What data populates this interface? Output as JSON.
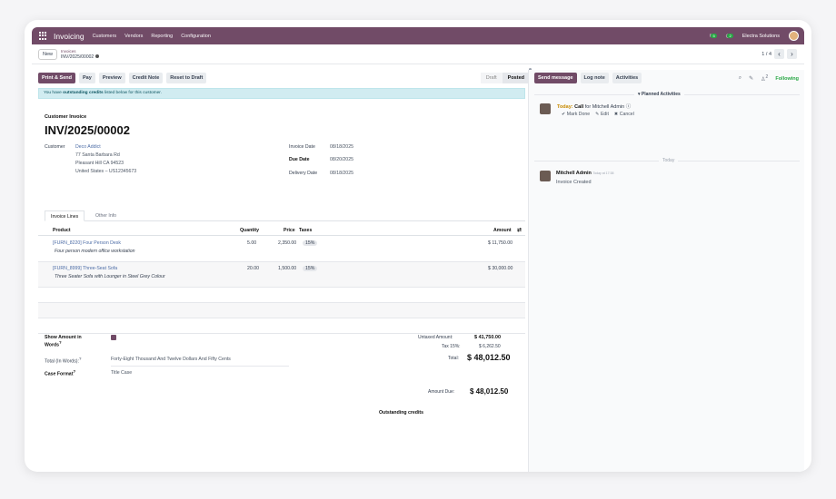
{
  "topnav": {
    "app_title": "Invoicing",
    "menu": [
      "Customers",
      "Vendors",
      "Reporting",
      "Configuration"
    ],
    "chat_badge": "5",
    "activity_badge": "2",
    "company": "Electra Solutions"
  },
  "control": {
    "new_label": "New",
    "breadcrumb_parent": "Invoices",
    "breadcrumb_current": "INV/2025/00002",
    "pager_text": "1 / 4"
  },
  "actions": [
    "Print & Send",
    "Pay",
    "Preview",
    "Credit Note",
    "Reset to Draft"
  ],
  "status": {
    "draft": "Draft",
    "posted": "Posted"
  },
  "alert": {
    "prefix": "You have ",
    "bold": "outstanding credits",
    "suffix": " listed below for this customer."
  },
  "invoice": {
    "type_label": "Customer Invoice",
    "number": "INV/2025/00002",
    "customer_label": "Customer",
    "customer_name": "Deco Addict",
    "address1": "77 Santa Barbara Rd",
    "address2": "Pleasant Hill CA 94523",
    "address3": "United States – US12345673",
    "invoice_date_label": "Invoice Date",
    "invoice_date": "08/18/2025",
    "due_date_label": "Due Date",
    "due_date": "08/20/2025",
    "delivery_date_label": "Delivery Date",
    "delivery_date": "08/18/2025"
  },
  "tabs": [
    "Invoice Lines",
    "Other Info"
  ],
  "table": {
    "headers": [
      "Product",
      "Quantity",
      "Price",
      "Taxes",
      "Amount"
    ],
    "rows": [
      {
        "product": "[FURN_8220] Four Person Desk",
        "desc": "Four person modern office workstation",
        "qty": "5.00",
        "price": "2,350.00",
        "tax": "15%",
        "amount": "$ 11,750.00"
      },
      {
        "product": "[FURN_8999] Three-Seat Sofa",
        "desc": "Three Seater Sofa with Lounger in Steel Grey Colour",
        "qty": "20.00",
        "price": "1,500.00",
        "tax": "15%",
        "amount": "$ 30,000.00"
      }
    ]
  },
  "footer": {
    "show_words_label_1": "Show Amount in",
    "show_words_label_2": "Words",
    "total_words_label": "Total (In Words):",
    "total_words": "Forty-Eight Thousand And Twelve Dollars And Fifty Cents",
    "case_format_label": "Case Format",
    "case_format": "Title Case",
    "untaxed_label": "Untaxed Amount:",
    "untaxed": "$ 41,750.00",
    "tax_label": "Tax 15%:",
    "tax": "$ 6,262.50",
    "total_label": "Total:",
    "total": "$ 48,012.50",
    "due_label": "Amount Due:",
    "due": "$ 48,012.50",
    "outstanding": "Outstanding credits"
  },
  "chatter": {
    "buttons": [
      "Send message",
      "Log note",
      "Activities"
    ],
    "followers": "2",
    "following": "Following",
    "planned": "▾ Planned Activities",
    "activity_today": "Today:",
    "activity_type": "Call",
    "activity_for": "for Mitchell Admin",
    "mark_done": "✔ Mark Done",
    "edit": "✎ Edit",
    "cancel": "✖ Cancel",
    "today_sep": "Today",
    "author": "Mitchell Admin",
    "author_time": "Today at 17:38",
    "message": "Invoice Created"
  }
}
